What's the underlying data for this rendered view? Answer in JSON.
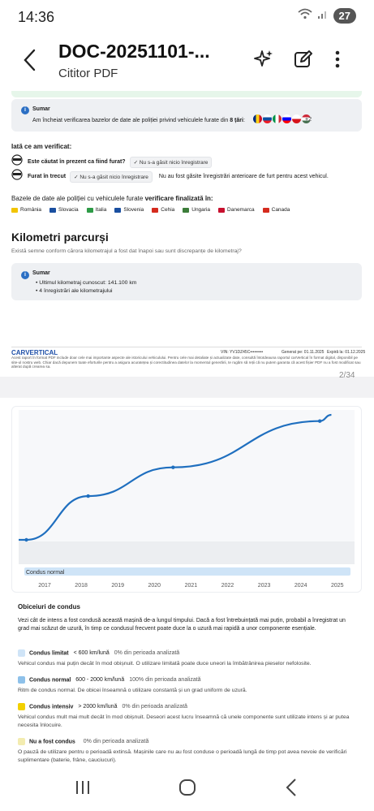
{
  "status": {
    "time": "14:36",
    "battery": "27"
  },
  "appbar": {
    "title": "DOC-20251101-...",
    "subtitle": "Cititor PDF"
  },
  "page1": {
    "summary_title": "Sumar",
    "summary_text": "Am încheiat verificarea bazelor de date ale poliției privind vehiculele furate din ",
    "summary_count": "8 țări",
    "summary_more": "+2",
    "verified_heading": "Iată ce am verificat:",
    "check1_label": "Este căutat în prezent ca fiind furat?",
    "check1_chip": "✓ Nu s-a găsit nicio înregistrare",
    "check2_label": "Furat în trecut",
    "check2_chip": "✓ Nu s-a găsit nicio înregistrare",
    "check2_note": "Nu au fost găsite înregistrări anterioare de furt pentru acest vehicul.",
    "databases_heading": "Bazele de date ale poliției cu vehiculele furate ",
    "databases_heading_bold": "verificare finalizată în:",
    "countries": [
      {
        "name": "România",
        "color": "#f2c400"
      },
      {
        "name": "Slovacia",
        "color": "#1a4fa0"
      },
      {
        "name": "Italia",
        "color": "#2e9b47"
      },
      {
        "name": "Slovenia",
        "color": "#1a4fa0"
      },
      {
        "name": "Cehia",
        "color": "#d52b1e"
      },
      {
        "name": "Ungaria",
        "color": "#3c7d3a"
      },
      {
        "name": "Danemarca",
        "color": "#c8102e"
      },
      {
        "name": "Canada",
        "color": "#d52b1e"
      }
    ],
    "km_title": "Kilometri parcurși",
    "km_subtitle": "Există semne conform cărora kilometrajul a fost dat înapoi sau sunt discrepanțe de kilometraj?",
    "km_summary_title": "Sumar",
    "km_bullet1": "Ultimul kilometraj cunoscut: 141.100 km",
    "km_bullet2": "4 înregistrări ale kilometrajului",
    "footer_brand": "CARVERTICAL",
    "footer_vin": "VIN: YV1DZ45C•••••••••",
    "footer_generated": "Generat pe: 01.11.2025",
    "footer_expires": "Expiră la: 01.12.2025",
    "footer_disclaimer": "Acest raport în format PDF include doar cele mai importante aspecte ale istoricului vehiculului. Pentru cele mai detaliate și actualizate date, consultă întotdeauna raportul carVertical în format digital, disponibil pe site-ul nostru web. Chiar dacă depunem toate eforturile pentru a asigura acuratețea și corectitudinea datelor la momentul generării, te rugăm să reții că nu putem garanta că acest fișier PDF nu a fost modificat sau alterat după crearea sa.",
    "page_indicator": "2/34"
  },
  "chart_data": {
    "type": "line",
    "x": [
      2016.5,
      2016.7,
      2018.3,
      2020.5,
      2024.3,
      2024.6
    ],
    "values": [
      0.0,
      0.0,
      0.35,
      0.58,
      0.95,
      1.0
    ],
    "xticks": [
      "2017",
      "2018",
      "2019",
      "2020",
      "2021",
      "2022",
      "2023",
      "2024",
      "2025"
    ],
    "band_label": "Condus normal",
    "color": "#1f6fbf"
  },
  "page2": {
    "habits_title": "Obiceiuri de condus",
    "habits_intro": "Vezi cât de intens a fost condusă această mașină de-a lungul timpului. Dacă a fost întrebuințată mai puțin, probabil a înregistrat un grad mai scăzut de uzură, în timp ce condusul frecvent poate duce la o uzură mai rapidă a unor componente esențiale.",
    "items": [
      {
        "name": "Condus limitat",
        "range": "< 600 km/lună",
        "pct": "0% din perioada analizată",
        "desc": "Vehicul condus mai puțin decât în mod obișnuit. O utilizare limitată poate duce uneori la îmbătrânirea pieselor nefolosite.",
        "color": "#cfe4f7"
      },
      {
        "name": "Condus normal",
        "range": "600 - 2000 km/lună",
        "pct": "100% din perioada analizată",
        "desc": "Ritm de condus normal. De obicei înseamnă o utilizare constantă și un grad uniform de uzură.",
        "color": "#8ec1ea"
      },
      {
        "name": "Condus intensiv",
        "range": "> 2000 km/lună",
        "pct": "0% din perioada analizată",
        "desc": "Vehicul condus mult mai mult decât în mod obișnuit. Deseori acest lucru înseamnă că unele componente sunt utilizate intens și ar putea necesita înlocuire.",
        "color": "#f2d000"
      },
      {
        "name": "Nu a fost condus",
        "range": "",
        "pct": "0% din perioada analizată",
        "desc": "O pauză de utilizare pentru o perioadă extinsă. Mașinile care nu au fost conduse o perioadă lungă de timp pot avea nevoie de verificări suplimentare (baterie, frâne, cauciucuri).",
        "color": "#f3ecb0"
      }
    ]
  }
}
